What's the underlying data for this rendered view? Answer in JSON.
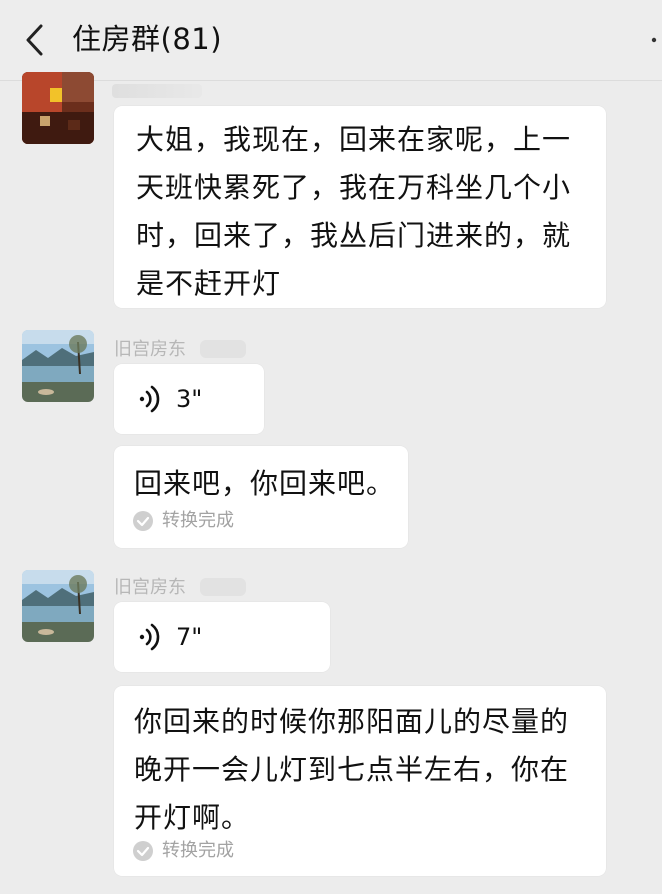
{
  "header": {
    "title": "住房群(81)"
  },
  "messages": [
    {
      "text": "大姐，我现在，回来在家呢，上一天班快累死了，我在万科坐几个小时，回来了，我丛后门进来的，就是不赶开灯"
    },
    {
      "sender": "旧宫房东",
      "voice_duration": "3\""
    },
    {
      "text": "回来吧，你回来吧。",
      "status": "转换完成"
    },
    {
      "sender": "旧宫房东",
      "voice_duration": "7\""
    },
    {
      "text": "你回来的时候你那阳面儿的尽量的晚开一会儿灯到七点半左右，你在开灯啊。",
      "status": "转换完成"
    }
  ],
  "colors": {
    "background": "#ececec",
    "bubble": "#ffffff",
    "muted": "#a3a3a3"
  },
  "icons": [
    "chevron-left-icon",
    "more-icon",
    "voice-icon",
    "check-icon"
  ]
}
